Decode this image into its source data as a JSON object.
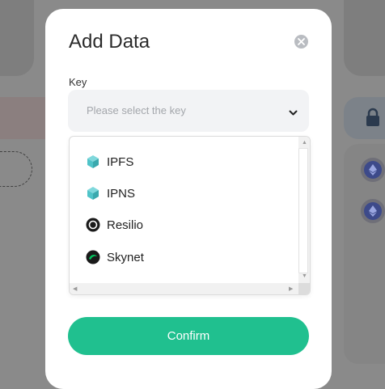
{
  "modal": {
    "title": "Add Data",
    "key_label": "Key",
    "select_placeholder": "Please select the key",
    "options": [
      {
        "label": "IPFS",
        "icon": "ipfs-cube-icon"
      },
      {
        "label": "IPNS",
        "icon": "ipns-cube-icon"
      },
      {
        "label": "Resilio",
        "icon": "resilio-icon"
      },
      {
        "label": "Skynet",
        "icon": "skynet-icon"
      }
    ],
    "confirm_label": "Confirm"
  },
  "colors": {
    "accent": "#20c08f",
    "overlay": "#8a8a8a",
    "ipfs_teal": "#4fc3c8"
  }
}
